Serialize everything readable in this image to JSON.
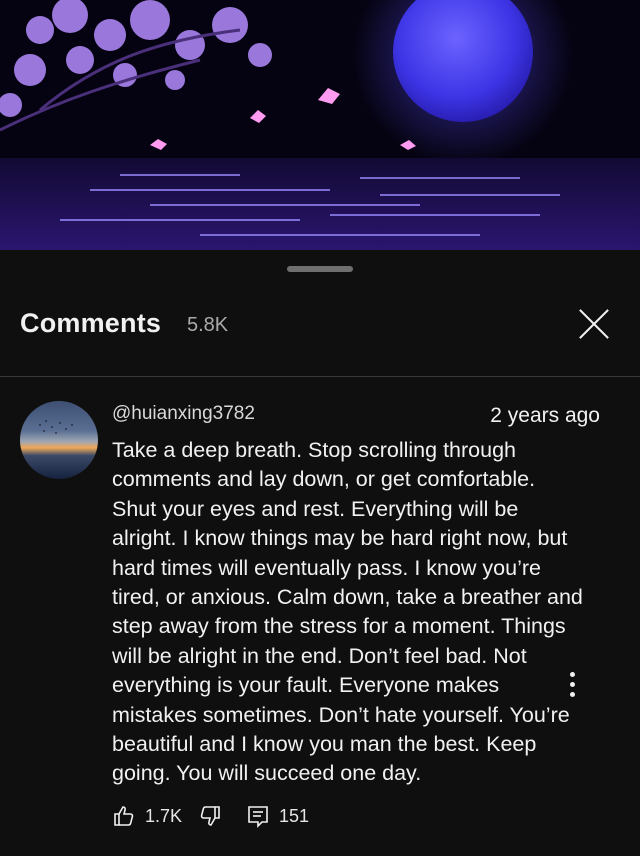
{
  "video": {
    "colors": {
      "sky": "#050312",
      "moon": "#4a43f5",
      "blossom": "#b48cff",
      "water": "#3a1f8a"
    }
  },
  "comments_panel": {
    "title": "Comments",
    "count": "5.8K",
    "close_icon": "close-icon"
  },
  "comment": {
    "author": "@huianxing3782",
    "time": "2 years ago",
    "text": "Take a deep breath. Stop scrolling through\ncomments and lay down, or  get comfortable.\nShut your eyes and rest. Everything will be\nalright. I know things may be hard right now, but\nhard times will eventually pass. I know you’re\ntired, or anxious. Calm down, take a breather and\nstep away from the stress for a moment. Things\nwill be alright in the end. Don’t feel bad. Not\neverything is your fault. Everyone makes\nmistakes sometimes. Don’t hate yourself. You’re\nbeautiful and I know you man the best. Keep\ngoing. You will succeed one day.",
    "likes": "1.7K",
    "replies": "151",
    "icons": [
      "thumbs-up-icon",
      "thumbs-down-icon",
      "reply-icon",
      "more-vertical-icon"
    ]
  }
}
